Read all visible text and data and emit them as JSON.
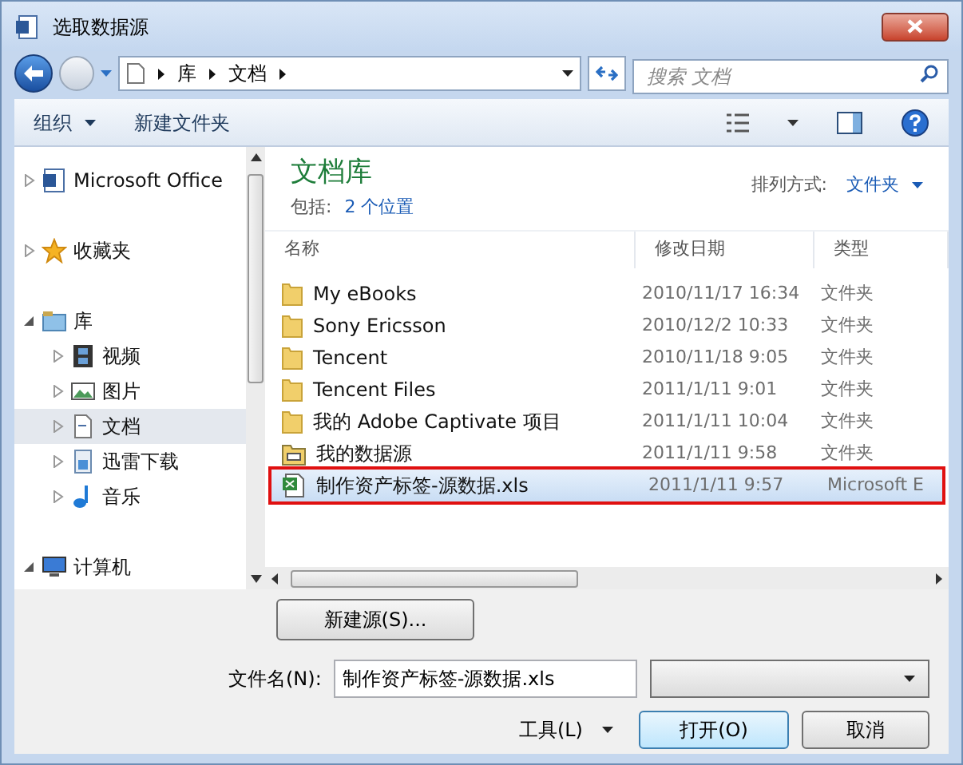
{
  "window": {
    "title": "选取数据源"
  },
  "address": {
    "crumbs": [
      "库",
      "文档"
    ]
  },
  "search": {
    "placeholder": "搜索 文档"
  },
  "toolbar": {
    "organize": "组织",
    "new_folder": "新建文件夹"
  },
  "sidebar": {
    "items": [
      {
        "label": "Microsoft Office",
        "expanded": false,
        "selected": false
      },
      {
        "label": "收藏夹",
        "expanded": false,
        "selected": false
      },
      {
        "label": "库",
        "expanded": true,
        "selected": false,
        "children": [
          {
            "label": "视频",
            "expanded": false,
            "selected": false
          },
          {
            "label": "图片",
            "expanded": false,
            "selected": false
          },
          {
            "label": "文档",
            "expanded": false,
            "selected": true
          },
          {
            "label": "迅雷下载",
            "expanded": false,
            "selected": false
          },
          {
            "label": "音乐",
            "expanded": false,
            "selected": false
          }
        ]
      },
      {
        "label": "计算机",
        "expanded": true,
        "selected": false
      }
    ]
  },
  "library": {
    "title": "文档库",
    "includes_label": "包括:",
    "includes_link": "2 个位置",
    "arrange_label": "排列方式:",
    "arrange_value": "文件夹"
  },
  "table": {
    "columns": [
      "名称",
      "修改日期",
      "类型"
    ],
    "rows": [
      {
        "name": "My eBooks",
        "date": "2010/11/17 16:34",
        "type": "文件夹",
        "kind": "folder",
        "selected": false
      },
      {
        "name": "Sony Ericsson",
        "date": "2010/12/2 10:33",
        "type": "文件夹",
        "kind": "folder",
        "selected": false
      },
      {
        "name": "Tencent",
        "date": "2010/11/18 9:05",
        "type": "文件夹",
        "kind": "folder",
        "selected": false
      },
      {
        "name": "Tencent Files",
        "date": "2011/1/11 9:01",
        "type": "文件夹",
        "kind": "folder",
        "selected": false
      },
      {
        "name": "我的 Adobe Captivate 项目",
        "date": "2011/1/11 10:04",
        "type": "文件夹",
        "kind": "folder",
        "selected": false
      },
      {
        "name": "我的数据源",
        "date": "2011/1/11 9:58",
        "type": "文件夹",
        "kind": "datasource",
        "selected": false
      },
      {
        "name": "制作资产标签-源数据.xls",
        "date": "2011/1/11 9:57",
        "type": "Microsoft E",
        "kind": "excel",
        "selected": true
      }
    ]
  },
  "new_source_button": "新建源(S)...",
  "filename": {
    "label": "文件名(N):",
    "value": "制作资产标签-源数据.xls"
  },
  "tools_button": "工具(L)",
  "open_button": "打开(O)",
  "cancel_button": "取消"
}
